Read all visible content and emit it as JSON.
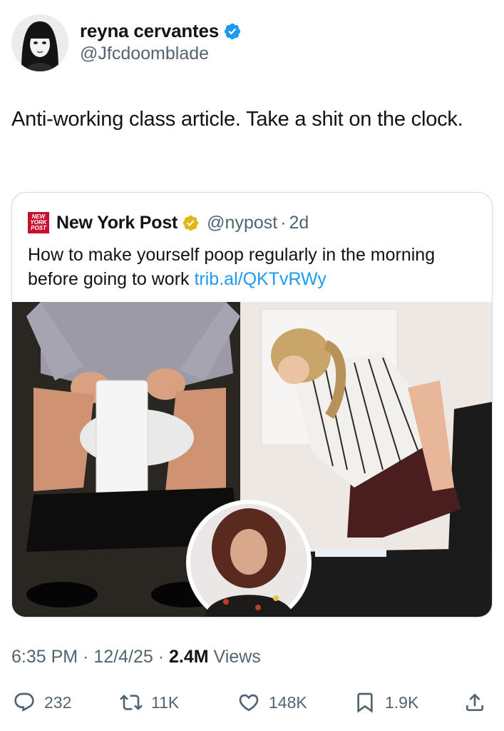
{
  "author": {
    "display_name": "reyna cervantes",
    "handle": "@Jfcdoomblade"
  },
  "tweet": {
    "text": "Anti-working class article. Take a shit on the clock."
  },
  "quote": {
    "logo_text": "NEW YORK POST",
    "display_name": "New York Post",
    "handle": "@nypost",
    "separator": "·",
    "time": "2d",
    "text": "How to make yourself poop regularly in the morning before going to work",
    "link": "trib.al/QKTvRWy"
  },
  "meta": {
    "time": "6:35 PM",
    "sep1": "·",
    "date": "12/4/25",
    "sep2": "·",
    "views_count": "2.4M",
    "views_label": "Views"
  },
  "actions": {
    "replies": "232",
    "reposts": "11K",
    "likes": "148K",
    "bookmarks": "1.9K"
  },
  "icons": {
    "verified_color": "#1d9bf0",
    "org_badge_color": "#e2b719",
    "link_color": "#1d9bf0"
  }
}
